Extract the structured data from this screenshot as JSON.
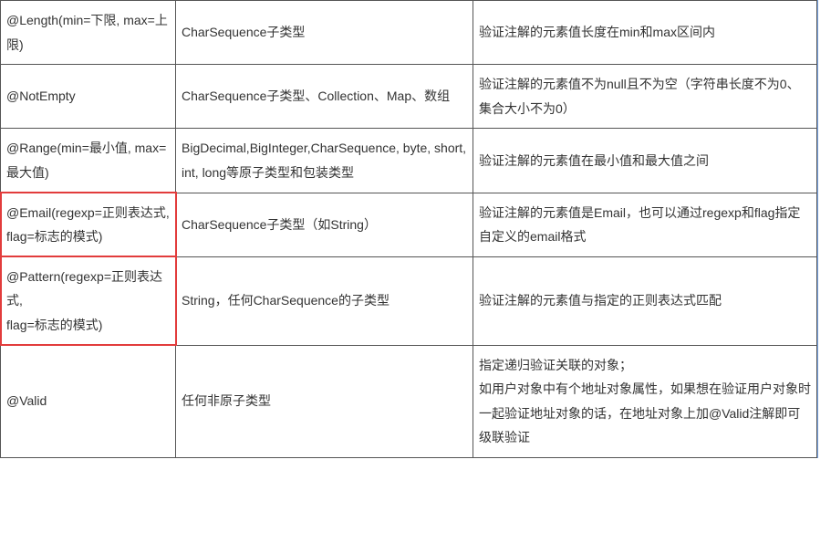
{
  "rows": [
    {
      "annotation": "@Length(min=下限, max=上限)",
      "type": "CharSequence子类型",
      "desc": "验证注解的元素值长度在min和max区间内"
    },
    {
      "annotation": "@NotEmpty",
      "type": "CharSequence子类型、Collection、Map、数组",
      "desc": "验证注解的元素值不为null且不为空（字符串长度不为0、集合大小不为0）"
    },
    {
      "annotation": "@Range(min=最小值, max=最大值)",
      "type": "BigDecimal,BigInteger,CharSequence, byte, short, int, long等原子类型和包装类型",
      "desc": "验证注解的元素值在最小值和最大值之间"
    },
    {
      "annotation": "@Email(regexp=正则表达式,\nflag=标志的模式)",
      "type": "CharSequence子类型（如String）",
      "desc": "验证注解的元素值是Email，也可以通过regexp和flag指定自定义的email格式"
    },
    {
      "annotation": "@Pattern(regexp=正则表达式,\nflag=标志的模式)",
      "type": "String，任何CharSequence的子类型",
      "desc": "验证注解的元素值与指定的正则表达式匹配"
    },
    {
      "annotation": "@Valid",
      "type": "任何非原子类型",
      "desc": "指定递归验证关联的对象；\n如用户对象中有个地址对象属性，如果想在验证用户对象时一起验证地址对象的话，在地址对象上加@Valid注解即可级联验证"
    }
  ]
}
